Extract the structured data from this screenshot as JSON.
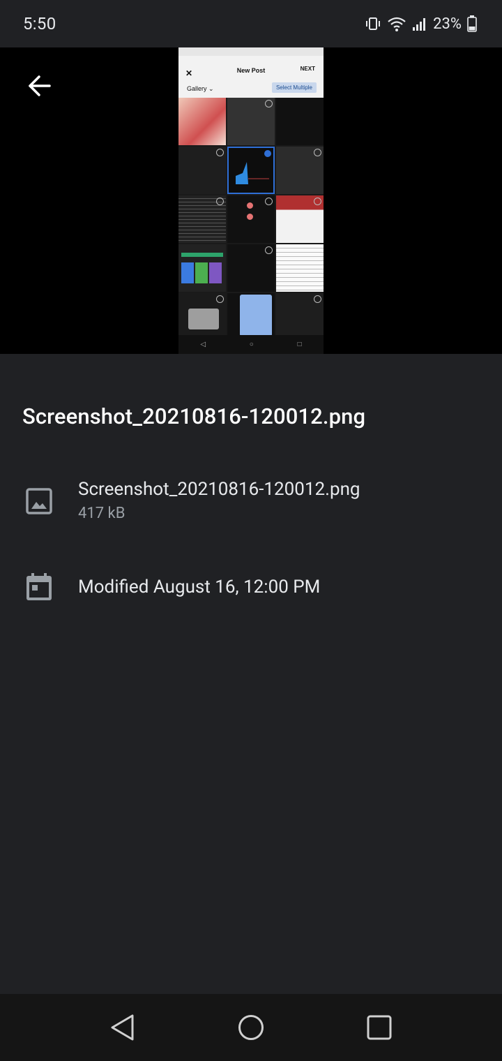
{
  "status_bar": {
    "time": "5:50",
    "battery": "23%",
    "icons": [
      "vibrate-icon",
      "wifi-icon",
      "signal-icon",
      "battery-icon"
    ]
  },
  "viewer": {
    "back_icon": "arrow-back-icon",
    "preview": {
      "close_label": "✕",
      "title": "New Post",
      "next_label": "NEXT",
      "gallery_label": "Gallery ⌄",
      "select_multiple_label": "Select Multiple"
    }
  },
  "details": {
    "title": "Screenshot_20210816-120012.png",
    "file_name": "Screenshot_20210816-120012.png",
    "file_size": "417 kB",
    "modified": "Modified August 16, 12:00 PM",
    "file_icon": "image-icon",
    "date_icon": "calendar-icon"
  },
  "nav_bar": {
    "icons": [
      "back-triangle-icon",
      "home-circle-icon",
      "recents-square-icon"
    ]
  },
  "colors": {
    "background": "#202124",
    "viewer_background": "#000000",
    "primary_text": "#e8eaed",
    "secondary_text": "#9aa0a6"
  }
}
